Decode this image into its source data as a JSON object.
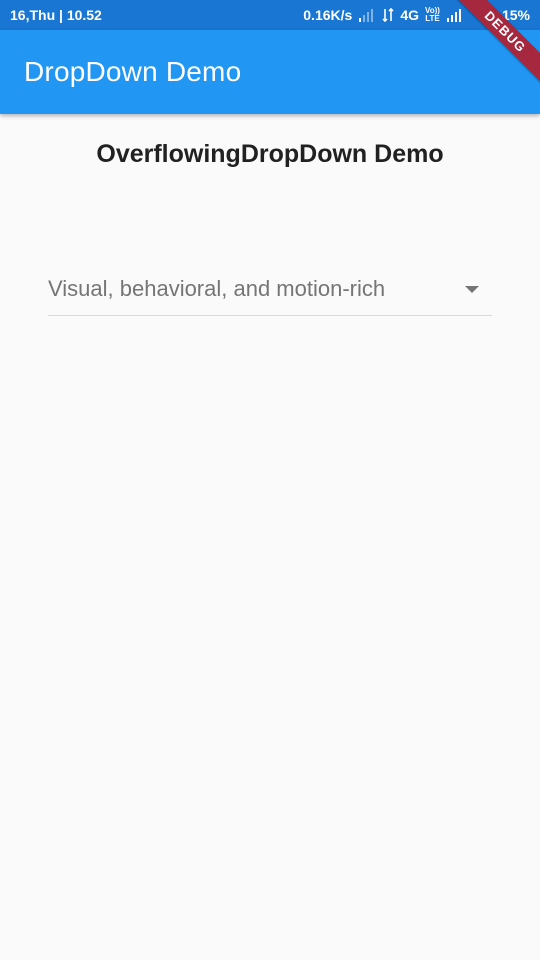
{
  "status_bar": {
    "left_text": "16,Thu | 10.52",
    "speed": "0.16K/s",
    "network": "4G",
    "volte_top": "Vo))",
    "volte_bottom": "LTE",
    "battery": "15%",
    "icons": [
      "signal-weak-icon",
      "data-arrows-icon",
      "volte-icon",
      "signal-icon"
    ]
  },
  "app_bar": {
    "title": "DropDown Demo",
    "color": "#2196f3"
  },
  "debug_banner": {
    "label": "DEBUG",
    "color": "#a5283f"
  },
  "main": {
    "heading": "OverflowingDropDown Demo",
    "dropdown": {
      "selected_value": "Visual, behavioral, and motion-rich",
      "icon": "arrow-drop-down-icon"
    }
  }
}
